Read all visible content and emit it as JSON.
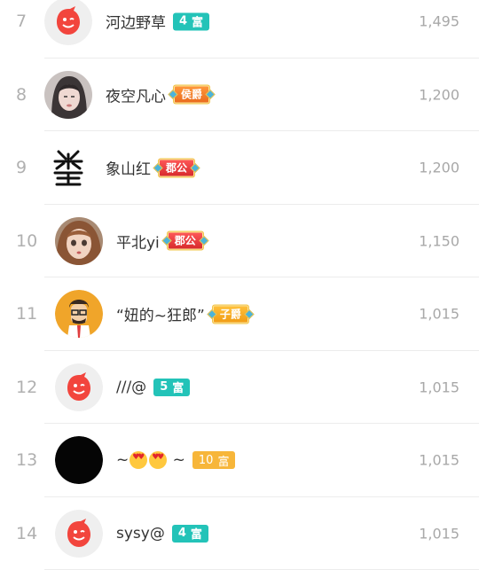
{
  "rows": [
    {
      "rank": "7",
      "name": "河边野草",
      "badge_type": "rich",
      "badge_level": "4",
      "badge_text": "富",
      "badge_color": "#23c3b8",
      "score": "1,495",
      "avatar": "red-mascot"
    },
    {
      "rank": "8",
      "name": "夜空凡心",
      "badge_type": "noble",
      "badge_text": "侯爵",
      "score": "1,200",
      "avatar": "photo-girl"
    },
    {
      "rank": "9",
      "name": "象山红",
      "badge_type": "noble",
      "badge_text": "郡公",
      "score": "1,200",
      "avatar": "calligraphy"
    },
    {
      "rank": "10",
      "name": "平北yi",
      "badge_type": "noble",
      "badge_text": "郡公",
      "score": "1,150",
      "avatar": "doll"
    },
    {
      "rank": "11",
      "name": "“妞的~狂郎”",
      "badge_type": "noble",
      "badge_text": "子爵",
      "score": "1,015",
      "avatar": "cartoon-man"
    },
    {
      "rank": "12",
      "name": "///@",
      "badge_type": "rich",
      "badge_level": "5",
      "badge_text": "富",
      "badge_color": "#23c3b8",
      "score": "1,015",
      "avatar": "red-mascot"
    },
    {
      "rank": "13",
      "name_prefix": "~",
      "name_suffix": "~",
      "badge_type": "rich",
      "badge_level": "10",
      "badge_text": "富",
      "badge_color": "#f7b63a",
      "score": "1,015",
      "avatar": "black-circle"
    },
    {
      "rank": "14",
      "name": "sysy@",
      "badge_type": "rich",
      "badge_level": "4",
      "badge_text": "富",
      "badge_color": "#23c3b8",
      "score": "1,015",
      "avatar": "red-mascot"
    }
  ]
}
